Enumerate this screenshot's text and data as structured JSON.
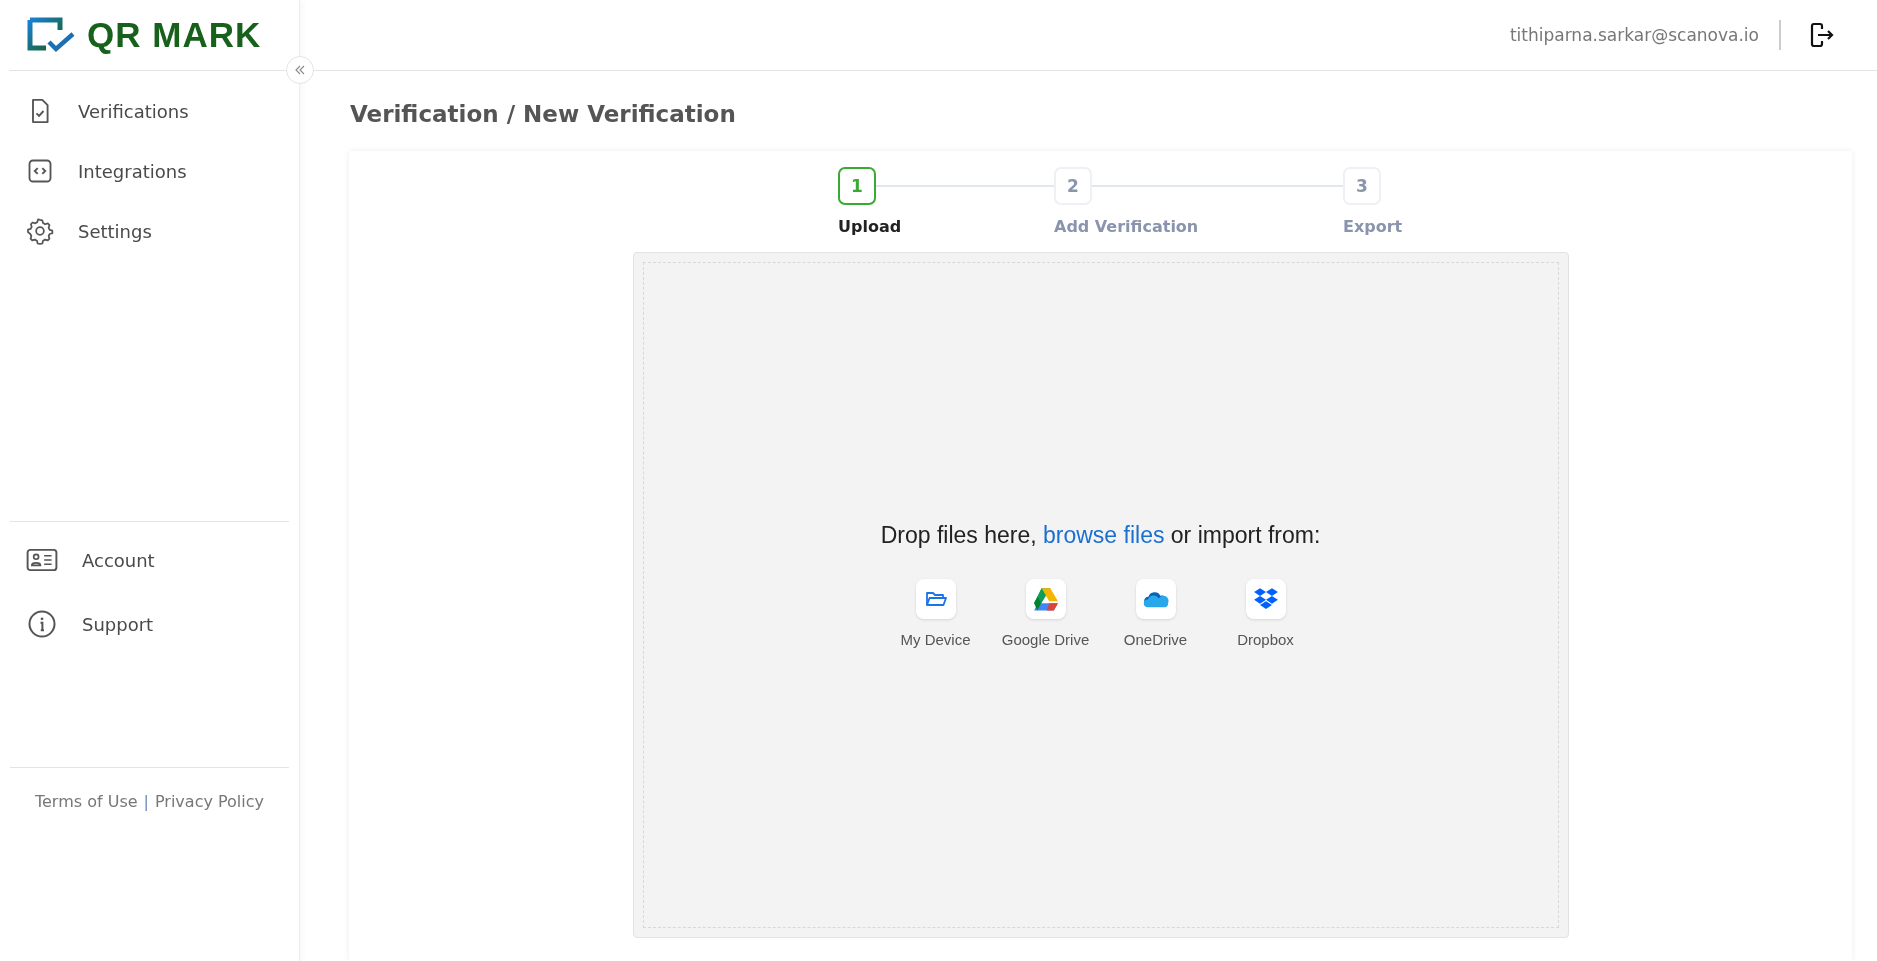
{
  "logo": {
    "text": "QR MARK"
  },
  "sidebar": {
    "items": [
      {
        "label": "Verifications",
        "kind": "file-check"
      },
      {
        "label": "Integrations",
        "kind": "code"
      },
      {
        "label": "Settings",
        "kind": "gear"
      }
    ],
    "bottom_items": [
      {
        "label": "Account",
        "kind": "id-card"
      },
      {
        "label": "Support",
        "kind": "info"
      }
    ],
    "footer_links": [
      "Terms of Use",
      "Privacy Policy"
    ],
    "footer_separator": "|"
  },
  "header": {
    "user_email": "tithiparna.sarkar@scanova.io"
  },
  "breadcrumb": "Verification / New Verification",
  "steps": [
    {
      "number": "1",
      "label": "Upload",
      "selected": true
    },
    {
      "number": "2",
      "label": "Add Verification",
      "selected": false
    },
    {
      "number": "3",
      "label": "Export",
      "selected": false
    }
  ],
  "dropzone": {
    "text_before": "Drop files here,",
    "link": "browse files",
    "text_after": "or import from:",
    "sources": [
      {
        "label": "My Device",
        "kind": "folder"
      },
      {
        "label": "Google Drive",
        "kind": "drive"
      },
      {
        "label": "OneDrive",
        "kind": "cloud"
      },
      {
        "label": "Dropbox",
        "kind": "dropbox"
      }
    ]
  }
}
